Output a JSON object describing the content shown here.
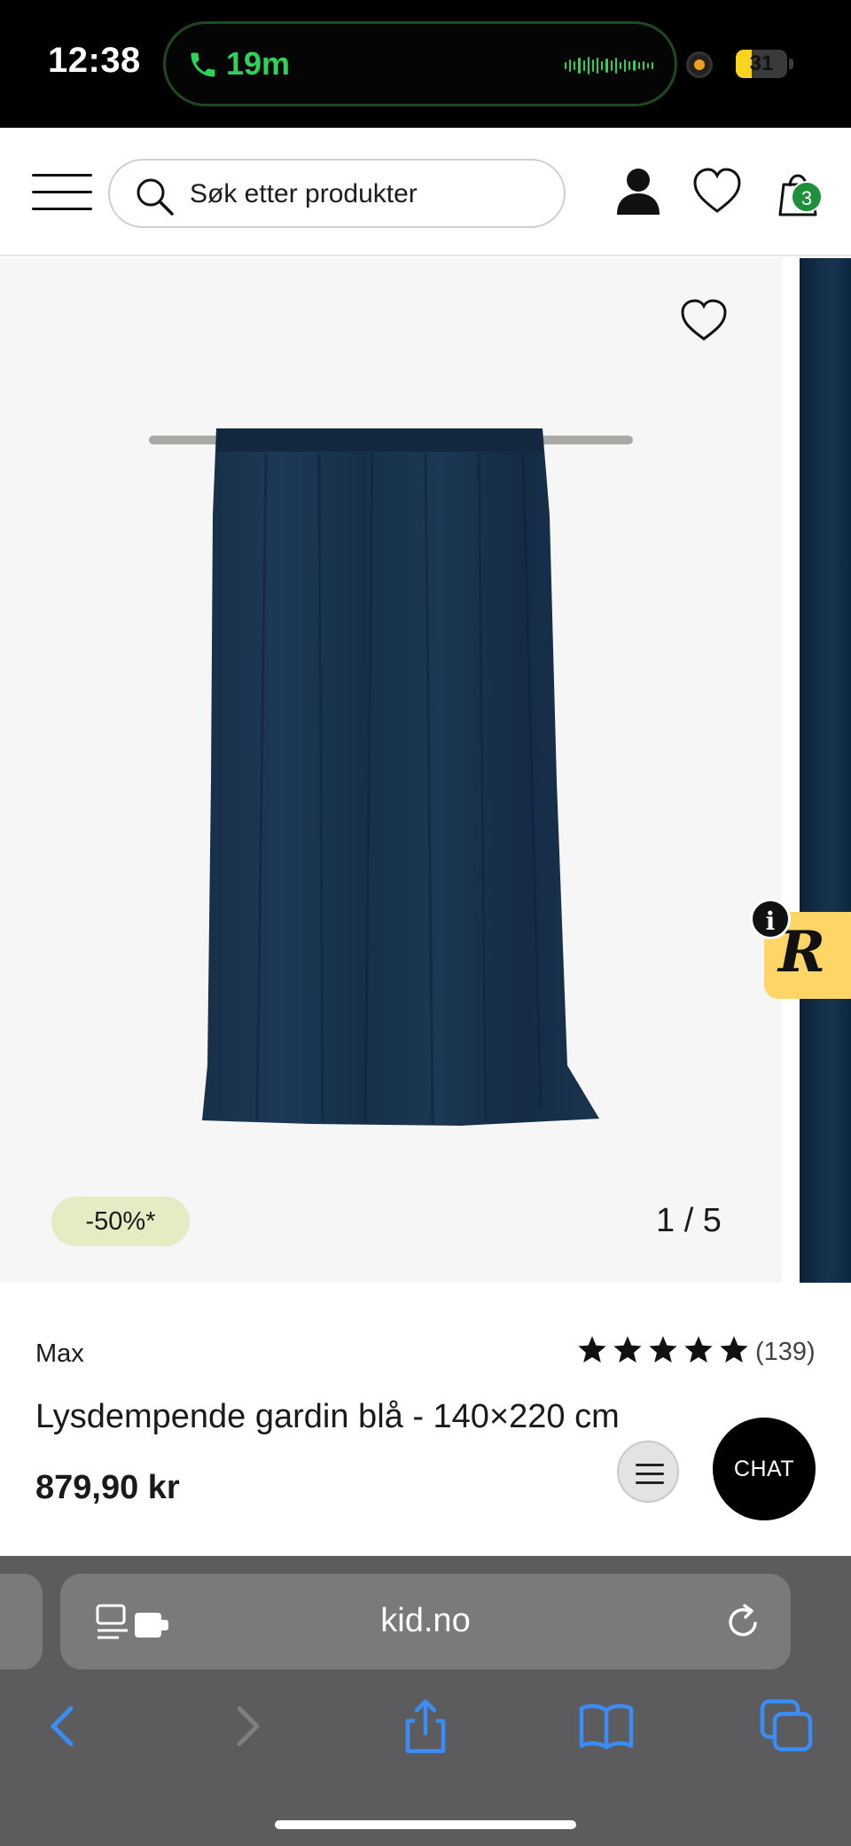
{
  "status_bar": {
    "time": "12:38",
    "call_duration": "19m",
    "battery_level": "31",
    "battery_fraction": 0.31,
    "colors": {
      "call_green": "#2fd158",
      "battery_yellow": "#f8d41e",
      "recording_dot": "#f0a018"
    }
  },
  "header": {
    "search": {
      "placeholder": "Søk etter produkter"
    },
    "cart_count": "3",
    "icons": [
      "menu-icon",
      "search-icon",
      "user-icon",
      "heart-icon",
      "shopping-bag-icon"
    ],
    "colors": {
      "cart_badge": "#1f8f3a"
    }
  },
  "gallery": {
    "discount_badge": "-50%*",
    "counter": "1 / 5",
    "current_slide": 1,
    "total_slides": 5,
    "widget": {
      "info_label": "i",
      "logo_letter": "R",
      "color": "#fdd667"
    },
    "image_alt_color": "#17344f"
  },
  "product": {
    "brand": "Max",
    "rating_stars": 5,
    "review_count": "(139)",
    "title": "Lysdempende gardin blå - 140×220 cm",
    "price": "879,90 kr",
    "chat_label": "CHAT"
  },
  "browser": {
    "url": "kid.no",
    "toolbar": [
      "back-icon",
      "forward-icon",
      "share-icon",
      "bookmarks-icon",
      "tabs-icon"
    ],
    "colors": {
      "link_blue": "#3a8cf6",
      "chrome_bg": "#5c5c5e"
    }
  }
}
